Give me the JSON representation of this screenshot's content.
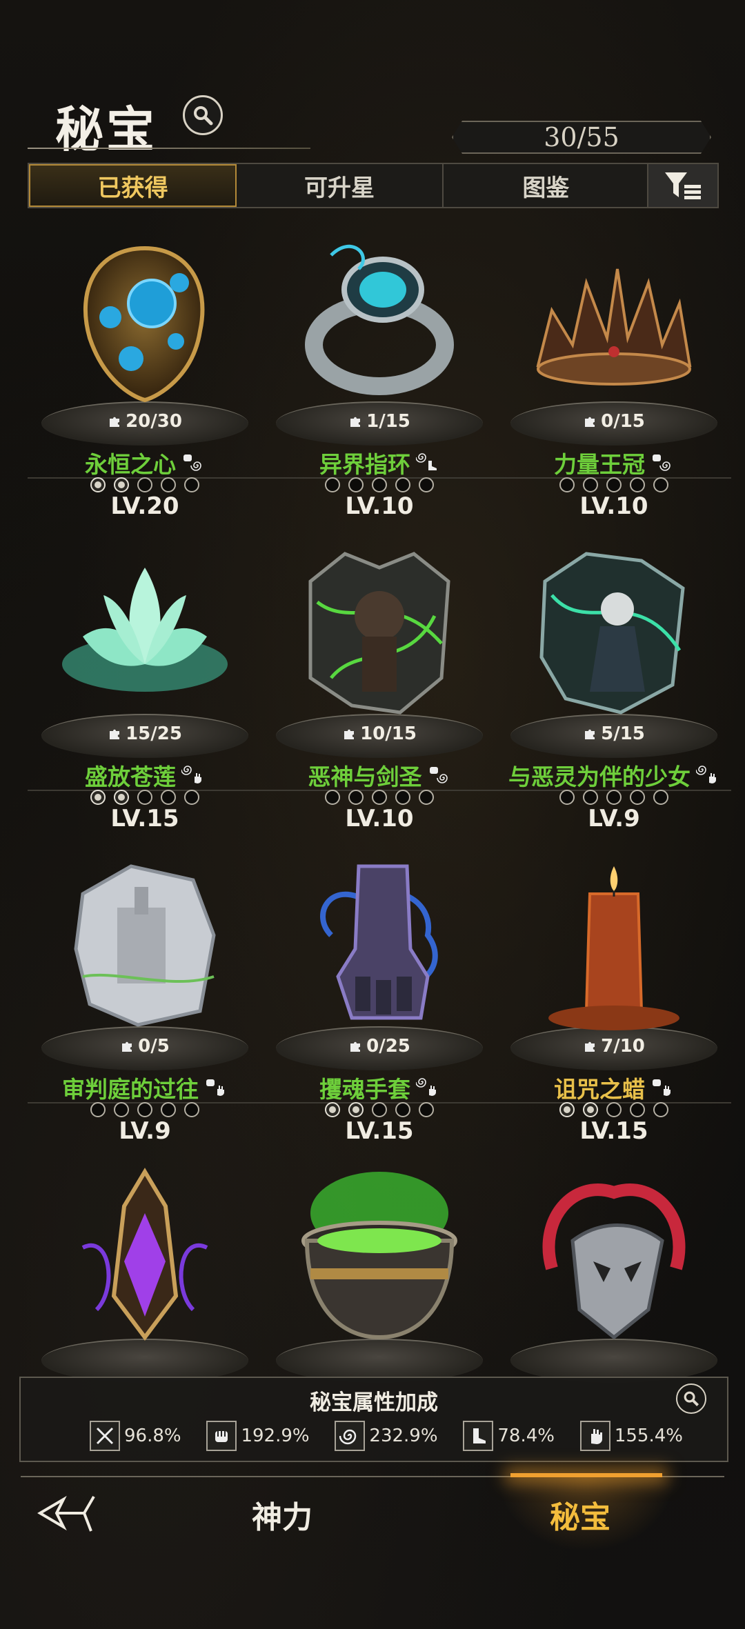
{
  "header": {
    "title": "秘宝",
    "count": "30/55"
  },
  "tabs": [
    {
      "label": "已获得",
      "active": true
    },
    {
      "label": "可升星",
      "active": false
    },
    {
      "label": "图鉴",
      "active": false
    }
  ],
  "items": [
    {
      "name": "永恒之心",
      "shards": "20/30",
      "level": "LV.20",
      "stars": 2,
      "type": "fist-swirl",
      "art": "heart"
    },
    {
      "name": "异界指环",
      "shards": "1/15",
      "level": "LV.10",
      "stars": 0,
      "type": "swirl-boot",
      "art": "ring"
    },
    {
      "name": "力量王冠",
      "shards": "0/15",
      "level": "LV.10",
      "stars": 0,
      "type": "fist-swirl",
      "art": "crown"
    },
    {
      "name": "盛放苍莲",
      "shards": "15/25",
      "level": "LV.15",
      "stars": 2,
      "type": "swirl-hand",
      "art": "lotus"
    },
    {
      "name": "恶神与剑圣",
      "shards": "10/15",
      "level": "LV.10",
      "stars": 0,
      "type": "fist-swirl",
      "art": "shard-green"
    },
    {
      "name": "与恶灵为伴的少女",
      "shards": "5/15",
      "level": "LV.9",
      "stars": 0,
      "type": "swirl-hand",
      "art": "shard-teal"
    },
    {
      "name": "审判庭的过往",
      "shards": "0/5",
      "level": "LV.9",
      "stars": 0,
      "type": "fist-hand",
      "art": "shard-castle"
    },
    {
      "name": "攫魂手套",
      "shards": "0/25",
      "level": "LV.15",
      "stars": 2,
      "type": "swirl-hand",
      "art": "gauntlet"
    },
    {
      "name": "诅咒之蜡",
      "shards": "7/10",
      "level": "LV.15",
      "stars": 2,
      "type": "fist-hand",
      "art": "candle",
      "gold": true
    },
    {
      "name": "",
      "shards": "",
      "level": "",
      "stars": 0,
      "type": "",
      "art": "lantern"
    },
    {
      "name": "",
      "shards": "",
      "level": "",
      "stars": 0,
      "type": "",
      "art": "cauldron"
    },
    {
      "name": "",
      "shards": "",
      "level": "",
      "stars": 0,
      "type": "",
      "art": "skull"
    }
  ],
  "bonus": {
    "title": "秘宝属性加成",
    "stats": [
      {
        "icon": "sword-icon",
        "value": "96.8%"
      },
      {
        "icon": "fist-icon",
        "value": "192.9%"
      },
      {
        "icon": "swirl-icon",
        "value": "232.9%"
      },
      {
        "icon": "boot-icon",
        "value": "78.4%"
      },
      {
        "icon": "hand-icon",
        "value": "155.4%"
      }
    ]
  },
  "nav": {
    "god": "神力",
    "treasure": "秘宝"
  },
  "colors": {
    "accent": "#f4bd3d",
    "name_green": "#6ecf3b",
    "name_gold": "#e8c04a"
  }
}
